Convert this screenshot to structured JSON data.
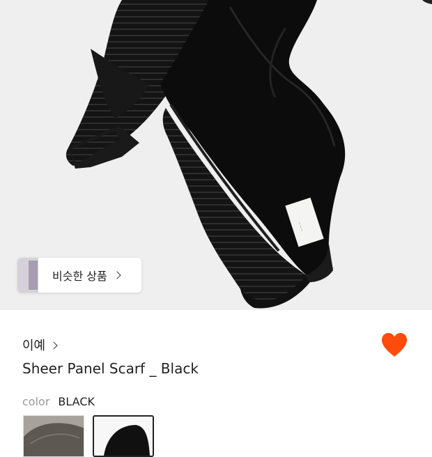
{
  "product_image": {
    "similar_button_label": "비슷한 상품"
  },
  "brand": {
    "name": "이예"
  },
  "product": {
    "title": "Sheer Panel Scarf _ Black",
    "color_label": "color",
    "color_value": "BLACK",
    "favorited": true
  },
  "colors": {
    "heart": "#ff4b0b",
    "hero_bg": "#efefef",
    "selected_border": "#222222"
  },
  "icons": {
    "similar": "chevron-right-icon",
    "brand": "chevron-right-icon",
    "wishlist": "heart-icon"
  }
}
